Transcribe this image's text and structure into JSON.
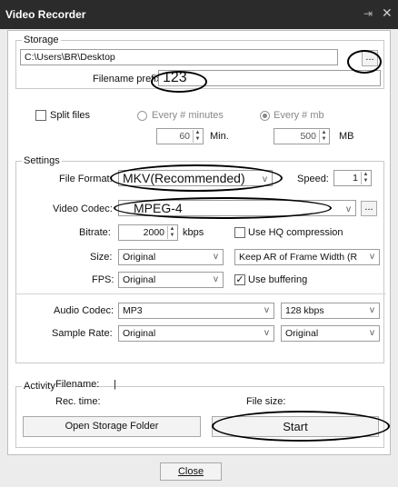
{
  "window": {
    "title": "Video Recorder",
    "pin_icon": "pin-icon",
    "close_icon": "close-icon"
  },
  "storage": {
    "legend": "Storage",
    "path": "C:\\Users\\BR\\Desktop",
    "browse_label": "...",
    "filename_prefix_label": "Filename prefix",
    "filename_prefix_value": "123",
    "split_files_label": "Split files",
    "split_files_checked": false,
    "every_minutes_label": "Every # minutes",
    "every_mb_label": "Every # mb",
    "minutes_value": "60",
    "minutes_unit": "Min.",
    "mb_value": "500",
    "mb_unit": "MB"
  },
  "settings": {
    "legend": "Settings",
    "file_format_label": "File Format:",
    "file_format_value": "MKV(Recommended)",
    "speed_label": "Speed:",
    "speed_value": "1",
    "video_codec_label": "Video Codec:",
    "video_codec_value": "MPEG-4",
    "codec_options_label": "...",
    "bitrate_label": "Bitrate:",
    "bitrate_value": "2000",
    "bitrate_unit": "kbps",
    "use_hq_label": "Use HQ compression",
    "use_hq_checked": false,
    "size_label": "Size:",
    "size_value": "Original",
    "keep_ar_value": "Keep AR of Frame Width (R",
    "fps_label": "FPS:",
    "fps_value": "Original",
    "use_buffering_label": "Use buffering",
    "use_buffering_checked": true,
    "audio_codec_label": "Audio Codec:",
    "audio_codec_value": "MP3",
    "audio_bitrate_value": "128 kbps",
    "sample_rate_label": "Sample Rate:",
    "sample_rate_value": "Original",
    "channels_value": "Original"
  },
  "activity": {
    "legend": "Activity",
    "filename_label": "Filename:",
    "filename_value": "|",
    "rec_time_label": "Rec. time:",
    "file_size_label": "File size:",
    "open_folder_label": "Open Storage Folder",
    "start_label": "Start"
  },
  "footer": {
    "close_label": "Close"
  }
}
